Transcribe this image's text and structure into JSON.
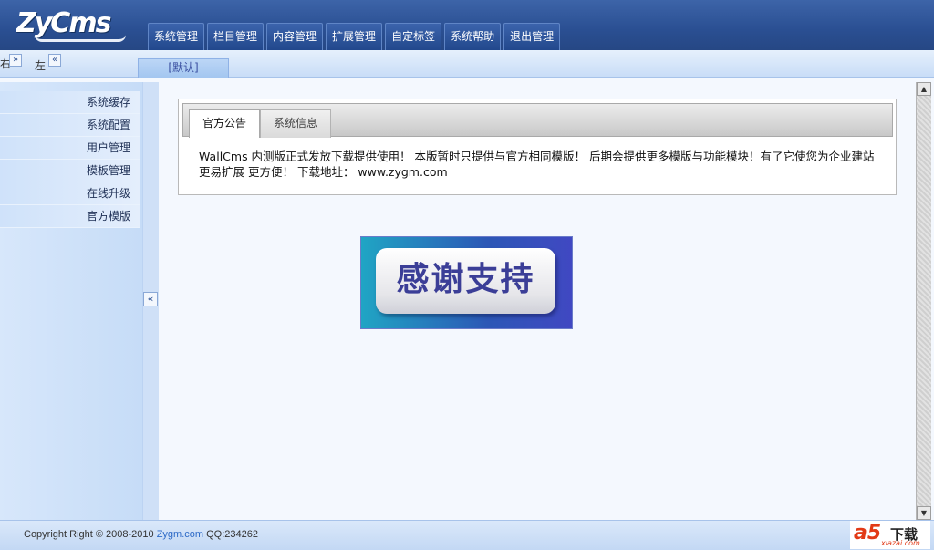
{
  "header": {
    "logo_text": "ZyCms",
    "nav": [
      {
        "label": "系统管理"
      },
      {
        "label": "栏目管理"
      },
      {
        "label": "内容管理"
      },
      {
        "label": "扩展管理"
      },
      {
        "label": "自定标签"
      },
      {
        "label": "系统帮助"
      },
      {
        "label": "退出管理"
      }
    ]
  },
  "toolbar": {
    "right_label": "右",
    "right_arrow": "»",
    "left_label": "左",
    "left_arrow": "«",
    "default_tab": "[默认]"
  },
  "sidebar": {
    "items": [
      {
        "label": "系统缓存"
      },
      {
        "label": "系统配置"
      },
      {
        "label": "用户管理"
      },
      {
        "label": "模板管理"
      },
      {
        "label": "在线升级"
      },
      {
        "label": "官方模版"
      }
    ],
    "collapse_label": "«"
  },
  "main": {
    "tabs": [
      {
        "label": "官方公告"
      },
      {
        "label": "系统信息"
      }
    ],
    "notice": "WallCms 内测版正式发放下载提供使用！ 本版暂时只提供与官方相同模版！ 后期会提供更多模版与功能模块！有了它使您为企业建站更易扩展 更方便！ 下载地址： www.zygm.com",
    "banner_text": "感谢支持"
  },
  "footer": {
    "copyright": "Copyright Right © 2008-2010",
    "site": "Zygm.com",
    "qq": "QQ:234262"
  },
  "watermark": {
    "brand": "a5",
    "label": "下载",
    "url": "xiazai.com"
  },
  "scrollbar": {
    "up": "▲",
    "down": "▼"
  }
}
